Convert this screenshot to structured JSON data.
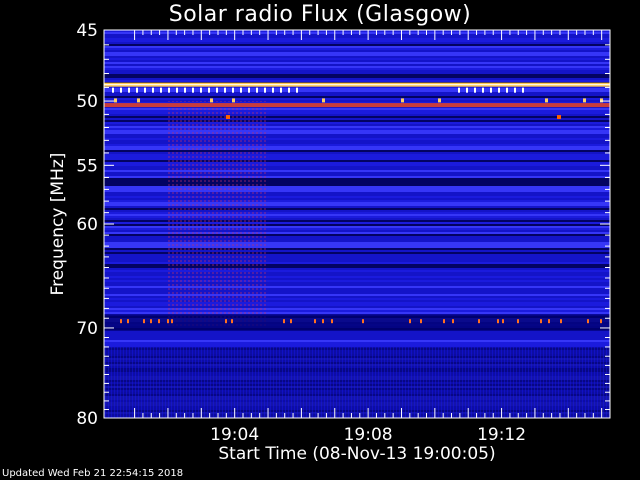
{
  "chart_data": {
    "type": "heatmap",
    "title": "Solar radio Flux (Glasgow)",
    "xlabel": "Start Time (08-Nov-13 19:00:05)",
    "ylabel": "Frequency [MHz]",
    "x_range": [
      "19:00:05",
      "19:15:15"
    ],
    "x_ticks": [
      "19:04",
      "19:08",
      "19:12"
    ],
    "y_range": [
      45,
      80
    ],
    "y_scale": "log",
    "y_ticks": [
      45,
      50,
      55,
      60,
      70,
      80
    ],
    "colormap": [
      "#000050",
      "#1414c8",
      "#3c3cff",
      "#b4286e",
      "#ff5000",
      "#ffc850"
    ],
    "features": [
      {
        "type": "interference-line",
        "frequency_mhz": 48.8,
        "color": "#ffc850"
      },
      {
        "type": "interference-line",
        "frequency_mhz": 50.3,
        "color": "#c83c3c"
      },
      {
        "type": "enhanced-band",
        "time_start": "19:02:00",
        "time_end": "19:05:00",
        "freq_range_mhz": [
          50,
          70
        ]
      },
      {
        "type": "spike-row",
        "frequency_mhz": 69.3
      }
    ]
  },
  "footer": "Updated Wed Feb 21 22:54:15 2018"
}
